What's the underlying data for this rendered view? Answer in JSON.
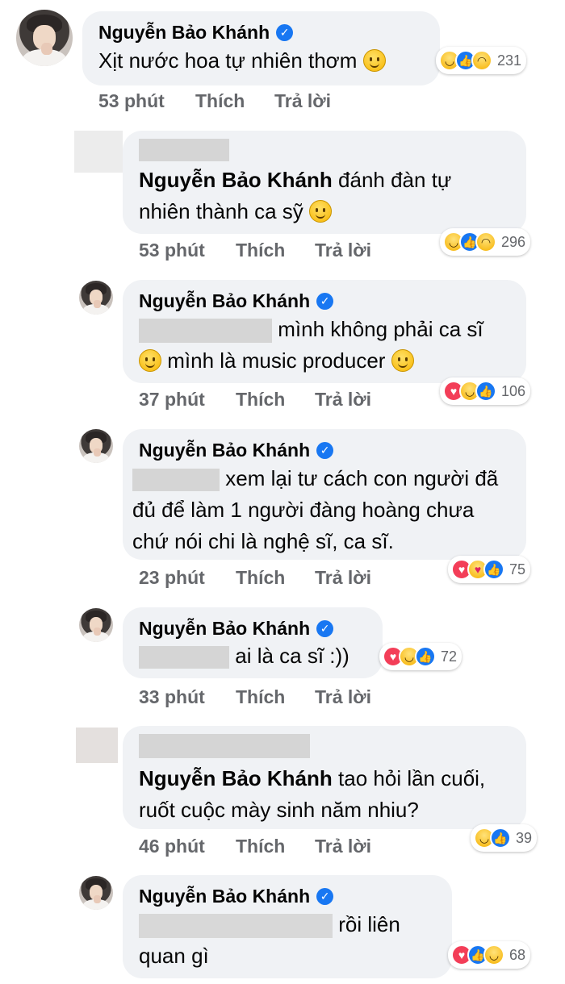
{
  "author_name": "Nguyễn Bảo Khánh",
  "actions": {
    "like": "Thích",
    "reply": "Trả lời"
  },
  "comments": [
    {
      "id": 1,
      "text": "Xịt nước hoa tự nhiên thơm",
      "time": "53 phút",
      "reactions": [
        "haha-icon",
        "like-icon",
        "sad-icon"
      ],
      "count": "231"
    },
    {
      "id": 2,
      "mention": "Nguyễn Bảo Khánh",
      "text_line1": "đánh đàn tự",
      "text_line2": "nhiên thành ca sỹ",
      "time": "53 phút",
      "reactions": [
        "haha-icon",
        "like-icon",
        "sad-icon"
      ],
      "count": "296"
    },
    {
      "id": 3,
      "text_line1": "mình không phải ca sĩ",
      "text_line2": "mình là music producer",
      "time": "37 phút",
      "reactions": [
        "love-icon",
        "haha-icon",
        "like-icon"
      ],
      "count": "106"
    },
    {
      "id": 4,
      "text_line1": "xem lại tư cách con người đã",
      "text_line2": "đủ để làm 1 người đàng hoàng chưa",
      "text_line3": "chứ nói chi là nghệ sĩ, ca sĩ.",
      "time": "23 phút",
      "reactions": [
        "love-icon",
        "care-icon",
        "like-icon"
      ],
      "count": "75"
    },
    {
      "id": 5,
      "text": "ai là ca sĩ :))",
      "time": "33 phút",
      "reactions": [
        "love-icon",
        "haha-icon",
        "like-icon"
      ],
      "count": "72"
    },
    {
      "id": 6,
      "mention": "Nguyễn Bảo Khánh",
      "text_line1": "tao hỏi lần cuối,",
      "text_line2": "ruốt cuộc mày sinh năm nhiu?",
      "time": "46 phút",
      "reactions": [
        "haha-icon",
        "like-icon"
      ],
      "count": "39"
    },
    {
      "id": 7,
      "text_line1": "rồi liên",
      "text_line2": "quan gì",
      "reactions": [
        "love-icon",
        "like-icon",
        "haha-icon"
      ],
      "count": "68"
    }
  ]
}
